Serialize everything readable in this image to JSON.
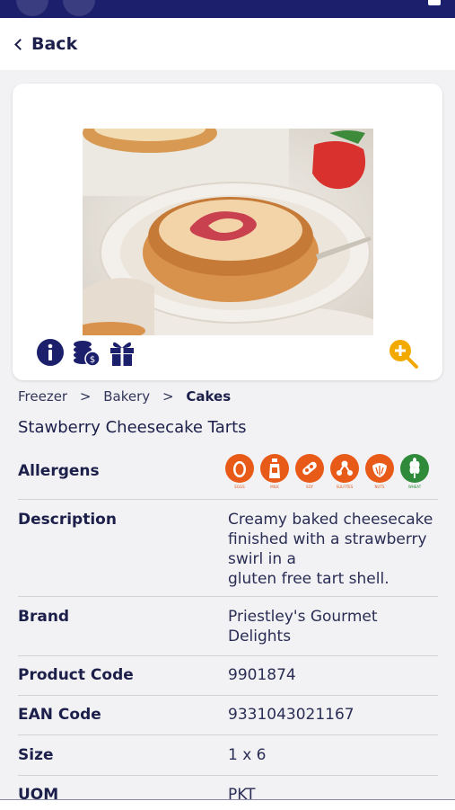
{
  "nav": {
    "back_label": "Back"
  },
  "breadcrumb": [
    "Freezer",
    "Bakery",
    "Cakes"
  ],
  "breadcrumb_sep": ">",
  "product": {
    "name": "Stawberry Cheesecake Tarts",
    "allergens_label": "Allergens",
    "allergens": [
      {
        "name": "EGGS",
        "color": "#e85a17"
      },
      {
        "name": "MILK",
        "color": "#e85a17"
      },
      {
        "name": "SOY",
        "color": "#e85a17"
      },
      {
        "name": "SULFITES",
        "color": "#e85a17"
      },
      {
        "name": "NUTS",
        "color": "#e85a17"
      },
      {
        "name": "WHEAT",
        "color": "#2f8a3a"
      }
    ],
    "details": [
      {
        "label": "Description",
        "value": "Creamy baked cheesecake finished with a strawberry swirl in a\ngluten free tart shell."
      },
      {
        "label": "Brand",
        "value": "Priestley's Gourmet Delights"
      },
      {
        "label": "Product Code",
        "value": "9901874"
      },
      {
        "label": "EAN Code",
        "value": "9331043021167"
      },
      {
        "label": "Size",
        "value": "1 x 6"
      },
      {
        "label": "UOM",
        "value": "PKT"
      }
    ]
  },
  "colors": {
    "brand": "#1c1f6b",
    "accent": "#f2a900",
    "allergen": "#e85a17",
    "wheat": "#2f8a3a"
  },
  "icons": [
    "info-icon",
    "coins-icon",
    "gift-icon",
    "zoom-in-icon"
  ]
}
